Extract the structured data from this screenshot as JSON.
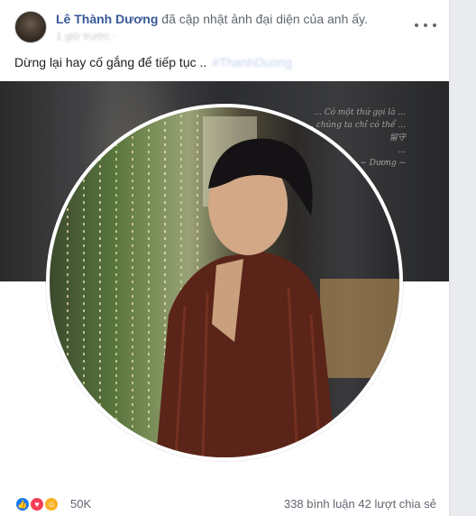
{
  "post": {
    "author": "Lê Thành Dương",
    "action": " đã cập nhật ảnh đại diện của anh ấy.",
    "timestamp_blurred": "1 giờ trước ·",
    "caption": "Dừng lại hay cố gắng để tiếp tục ..",
    "caption_link_blurred": "#ThanhDuong",
    "more_icon": "ellipsis-icon"
  },
  "cover": {
    "text_lines": [
      "... Có một thứ gọi là ...",
      "... chúng ta chỉ có thể ...",
      "留守",
      "...",
      "~ Dương ~"
    ]
  },
  "reactions": {
    "icons": [
      "like-icon",
      "love-icon",
      "care-icon"
    ],
    "count": "50K",
    "comments": "338 bình luận",
    "shares": "42 lượt chia sẻ"
  },
  "colors": {
    "author": "#385898",
    "like": "#1877f2",
    "love": "#f33e58",
    "care": "#f7b125"
  }
}
